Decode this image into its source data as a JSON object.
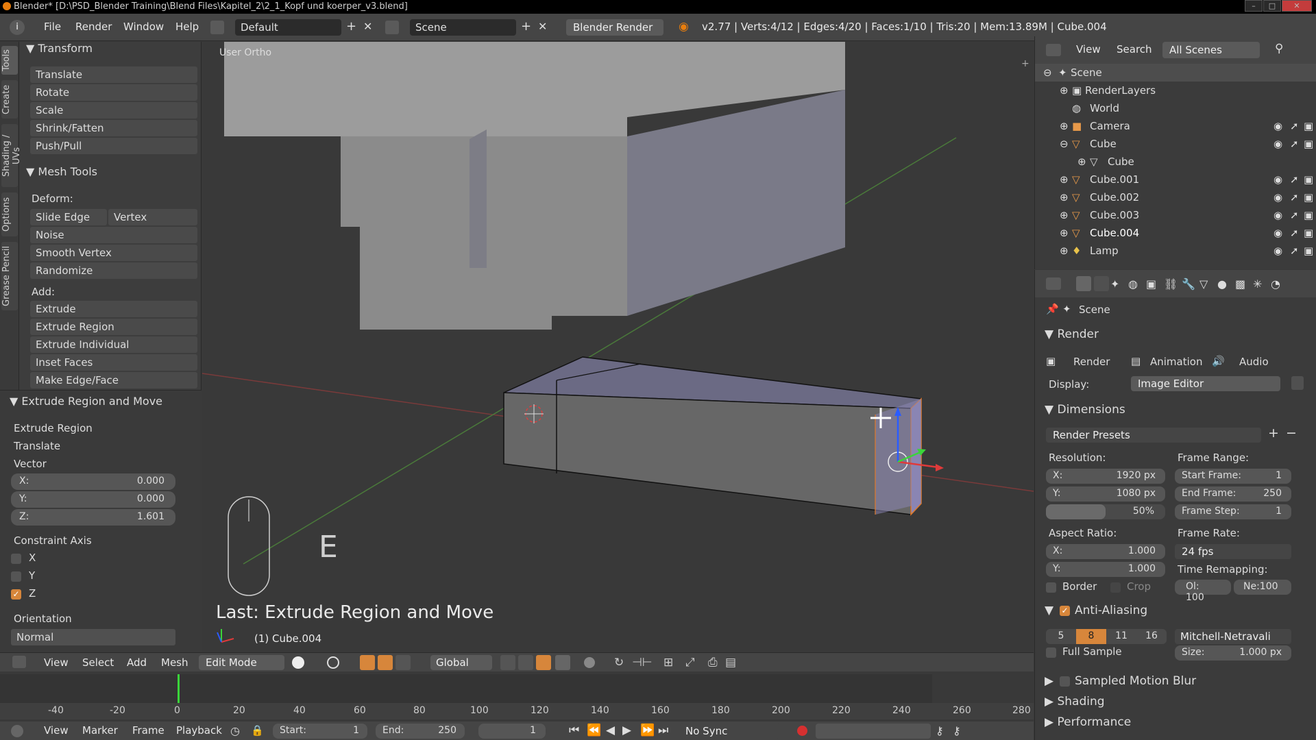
{
  "window": {
    "title": "Blender* [D:\\PSD_Blender Training\\Blend Files\\Kapitel_2\\2_1_Kopf und koerper_v3.blend]"
  },
  "infobar": {
    "menus": [
      "File",
      "Render",
      "Window",
      "Help"
    ],
    "layout": "Default",
    "scene": "Scene",
    "engine": "Blender Render",
    "stats": "v2.77 | Verts:4/12 | Edges:4/20 | Faces:1/10 | Tris:20 | Mem:13.89M | Cube.004"
  },
  "tool_tabs": [
    "Tools",
    "Create",
    "Shading / UVs",
    "Options",
    "Grease Pencil"
  ],
  "transform": {
    "header": "Transform",
    "items": [
      "Translate",
      "Rotate",
      "Scale",
      "Shrink/Fatten",
      "Push/Pull"
    ]
  },
  "mesh_tools": {
    "header": "Mesh Tools",
    "deform_label": "Deform:",
    "slide_edge": "Slide Edge",
    "vertex": "Vertex",
    "deform_items": [
      "Noise",
      "Smooth Vertex",
      "Randomize"
    ],
    "add_label": "Add:",
    "add_items": [
      "Extrude",
      "Extrude Region",
      "Extrude Individual",
      "Inset Faces",
      "Make Edge/Face"
    ]
  },
  "operator": {
    "header": "Extrude Region and Move",
    "extrude_region": "Extrude Region",
    "translate": "Translate",
    "vector_label": "Vector",
    "x_label": "X:",
    "x": "0.000",
    "y_label": "Y:",
    "y": "0.000",
    "z_label": "Z:",
    "z": "1.601",
    "constraint_label": "Constraint Axis",
    "axis_x": "X",
    "axis_y": "Y",
    "axis_z": "Z",
    "orientation_label": "Orientation",
    "orientation": "Normal"
  },
  "viewport": {
    "view_name": "User Ortho",
    "key_hint": "E",
    "last_op": "Last: Extrude Region and Move",
    "object_label": "(1) Cube.004"
  },
  "view3d_header": {
    "menus": [
      "View",
      "Select",
      "Add",
      "Mesh"
    ],
    "mode": "Edit Mode",
    "orientation": "Global"
  },
  "timeline": {
    "ticks": [
      "-40",
      "-20",
      "0",
      "20",
      "40",
      "60",
      "80",
      "100",
      "120",
      "140",
      "160",
      "180",
      "200",
      "220",
      "240",
      "260",
      "280"
    ],
    "menus": [
      "View",
      "Marker",
      "Frame",
      "Playback"
    ],
    "start_label": "Start:",
    "start": "1",
    "end_label": "End:",
    "end": "250",
    "current": "1",
    "sync": "No Sync"
  },
  "outliner": {
    "menus": [
      "View",
      "Search"
    ],
    "filter": "All Scenes",
    "items": [
      {
        "name": "Scene"
      },
      {
        "name": "RenderLayers"
      },
      {
        "name": "World"
      },
      {
        "name": "Camera"
      },
      {
        "name": "Cube"
      },
      {
        "name": "Cube"
      },
      {
        "name": "Cube.001"
      },
      {
        "name": "Cube.002"
      },
      {
        "name": "Cube.003"
      },
      {
        "name": "Cube.004"
      },
      {
        "name": "Lamp"
      }
    ]
  },
  "properties": {
    "context": "Scene",
    "render": {
      "header": "Render",
      "render_btn": "Render",
      "animation_btn": "Animation",
      "audio_btn": "Audio",
      "display_label": "Display:",
      "display": "Image Editor"
    },
    "dimensions": {
      "header": "Dimensions",
      "presets": "Render Presets",
      "resolution_label": "Resolution:",
      "res_x_label": "X:",
      "res_x": "1920 px",
      "res_y_label": "Y:",
      "res_y": "1080 px",
      "res_pct": "50%",
      "frame_range_label": "Frame Range:",
      "start_label": "Start Frame:",
      "start": "1",
      "end_label": "End Frame:",
      "end": "250",
      "step_label": "Frame Step:",
      "step": "1",
      "aspect_label": "Aspect Ratio:",
      "asp_x_label": "X:",
      "asp_x": "1.000",
      "asp_y_label": "Y:",
      "asp_y": "1.000",
      "frame_rate_label": "Frame Rate:",
      "fps": "24 fps",
      "time_remap_label": "Time Remapping:",
      "ol": "Ol: 100",
      "ne": "Ne:100",
      "border": "Border",
      "crop": "Crop"
    },
    "aa": {
      "header": "Anti-Aliasing",
      "samples": [
        "5",
        "8",
        "11",
        "16"
      ],
      "filter": "Mitchell-Netravali",
      "full_sample": "Full Sample",
      "size_label": "Size:",
      "size": "1.000 px"
    },
    "collapsed": [
      "Sampled Motion Blur",
      "Shading",
      "Performance"
    ]
  },
  "colors": {
    "accent": "#d7863b",
    "selected_face": "#8a85b3",
    "bg": "#393939"
  }
}
